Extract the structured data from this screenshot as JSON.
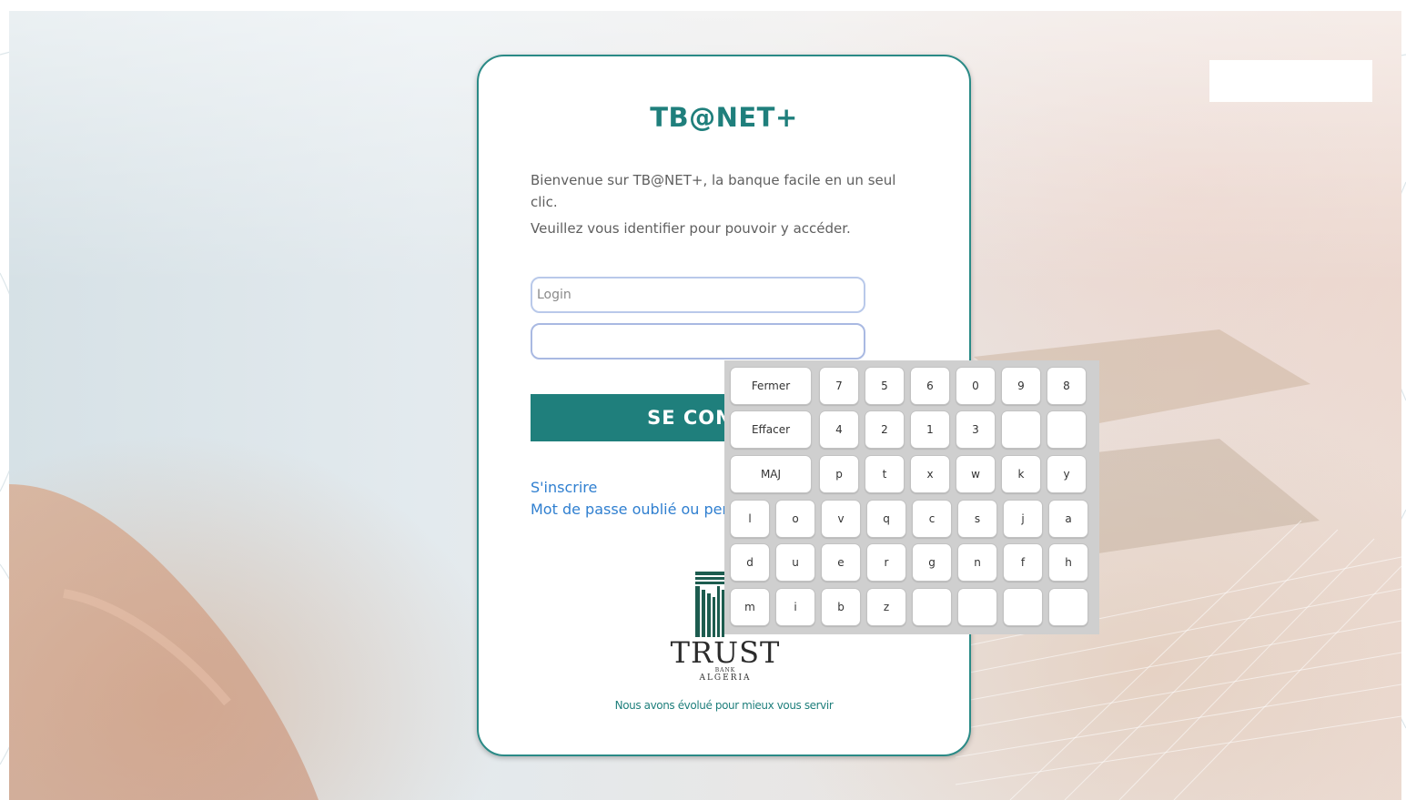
{
  "login_card": {
    "title": "TB@NET+",
    "welcome_text": "Bienvenue sur TB@NET+, la banque facile en un seul clic.",
    "prompt_text": "Veuillez vous identifier pour pouvoir y accéder.",
    "login_placeholder": "Login",
    "password_value": "",
    "connect_label": "SE CONNECTER",
    "signup_link": "S'inscrire",
    "forgot_link": "Mot de passe oublié ou perdu",
    "slogan": "Nous avons évolué pour mieux vous servir",
    "accent_color": "#1f7f7c",
    "link_color": "#2f7fd0"
  },
  "logo": {
    "icon": "trust-bank-logo-icon",
    "word": "TRUST",
    "sub_line_1": "BANK",
    "sub_line_2": "ALGERIA"
  },
  "virtual_keyboard": {
    "rows": [
      [
        "Fermer",
        "7",
        "5",
        "6",
        "0",
        "9",
        "8"
      ],
      [
        "Effacer",
        "4",
        "2",
        "1",
        "3",
        "",
        ""
      ],
      [
        "MAJ",
        "p",
        "t",
        "x",
        "w",
        "k",
        "y"
      ],
      [
        "l",
        "o",
        "v",
        "q",
        "c",
        "s",
        "j",
        "a"
      ],
      [
        "d",
        "u",
        "e",
        "r",
        "g",
        "n",
        "f",
        "h"
      ],
      [
        "m",
        "i",
        "b",
        "z",
        "",
        "",
        "",
        ""
      ]
    ]
  }
}
